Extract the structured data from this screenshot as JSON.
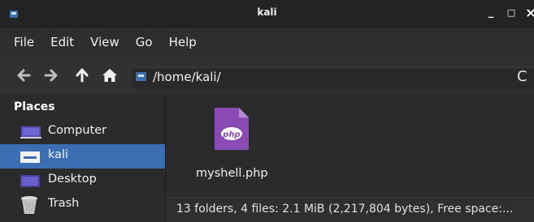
{
  "window": {
    "title": "kali",
    "minimize_label": "_",
    "maximize_label": "□",
    "close_label": "×"
  },
  "menu": [
    {
      "label": "File"
    },
    {
      "label": "Edit"
    },
    {
      "label": "View"
    },
    {
      "label": "Go"
    },
    {
      "label": "Help"
    }
  ],
  "toolbar": {
    "path": "/home/kali/",
    "back_icon": "back-arrow-icon",
    "forward_icon": "forward-arrow-icon",
    "up_icon": "up-arrow-icon",
    "home_icon": "home-icon",
    "reload_icon": "reload-icon"
  },
  "sidebar": {
    "header": "Places",
    "items": [
      {
        "label": "Computer",
        "icon": "computer-icon",
        "selected": false
      },
      {
        "label": "kali",
        "icon": "home-folder-icon",
        "selected": true
      },
      {
        "label": "Desktop",
        "icon": "desktop-icon",
        "selected": false
      },
      {
        "label": "Trash",
        "icon": "trash-icon",
        "selected": false
      }
    ]
  },
  "files": [
    {
      "name": "myshell.php",
      "icon": "php-file-icon",
      "icon_label": "php"
    }
  ],
  "status": {
    "text": "13 folders, 4 files: 2.1 MiB (2,217,804 bytes), Free space:..."
  },
  "colors": {
    "selection": "#3c6eb4",
    "php_icon": "#8a4bb5"
  }
}
